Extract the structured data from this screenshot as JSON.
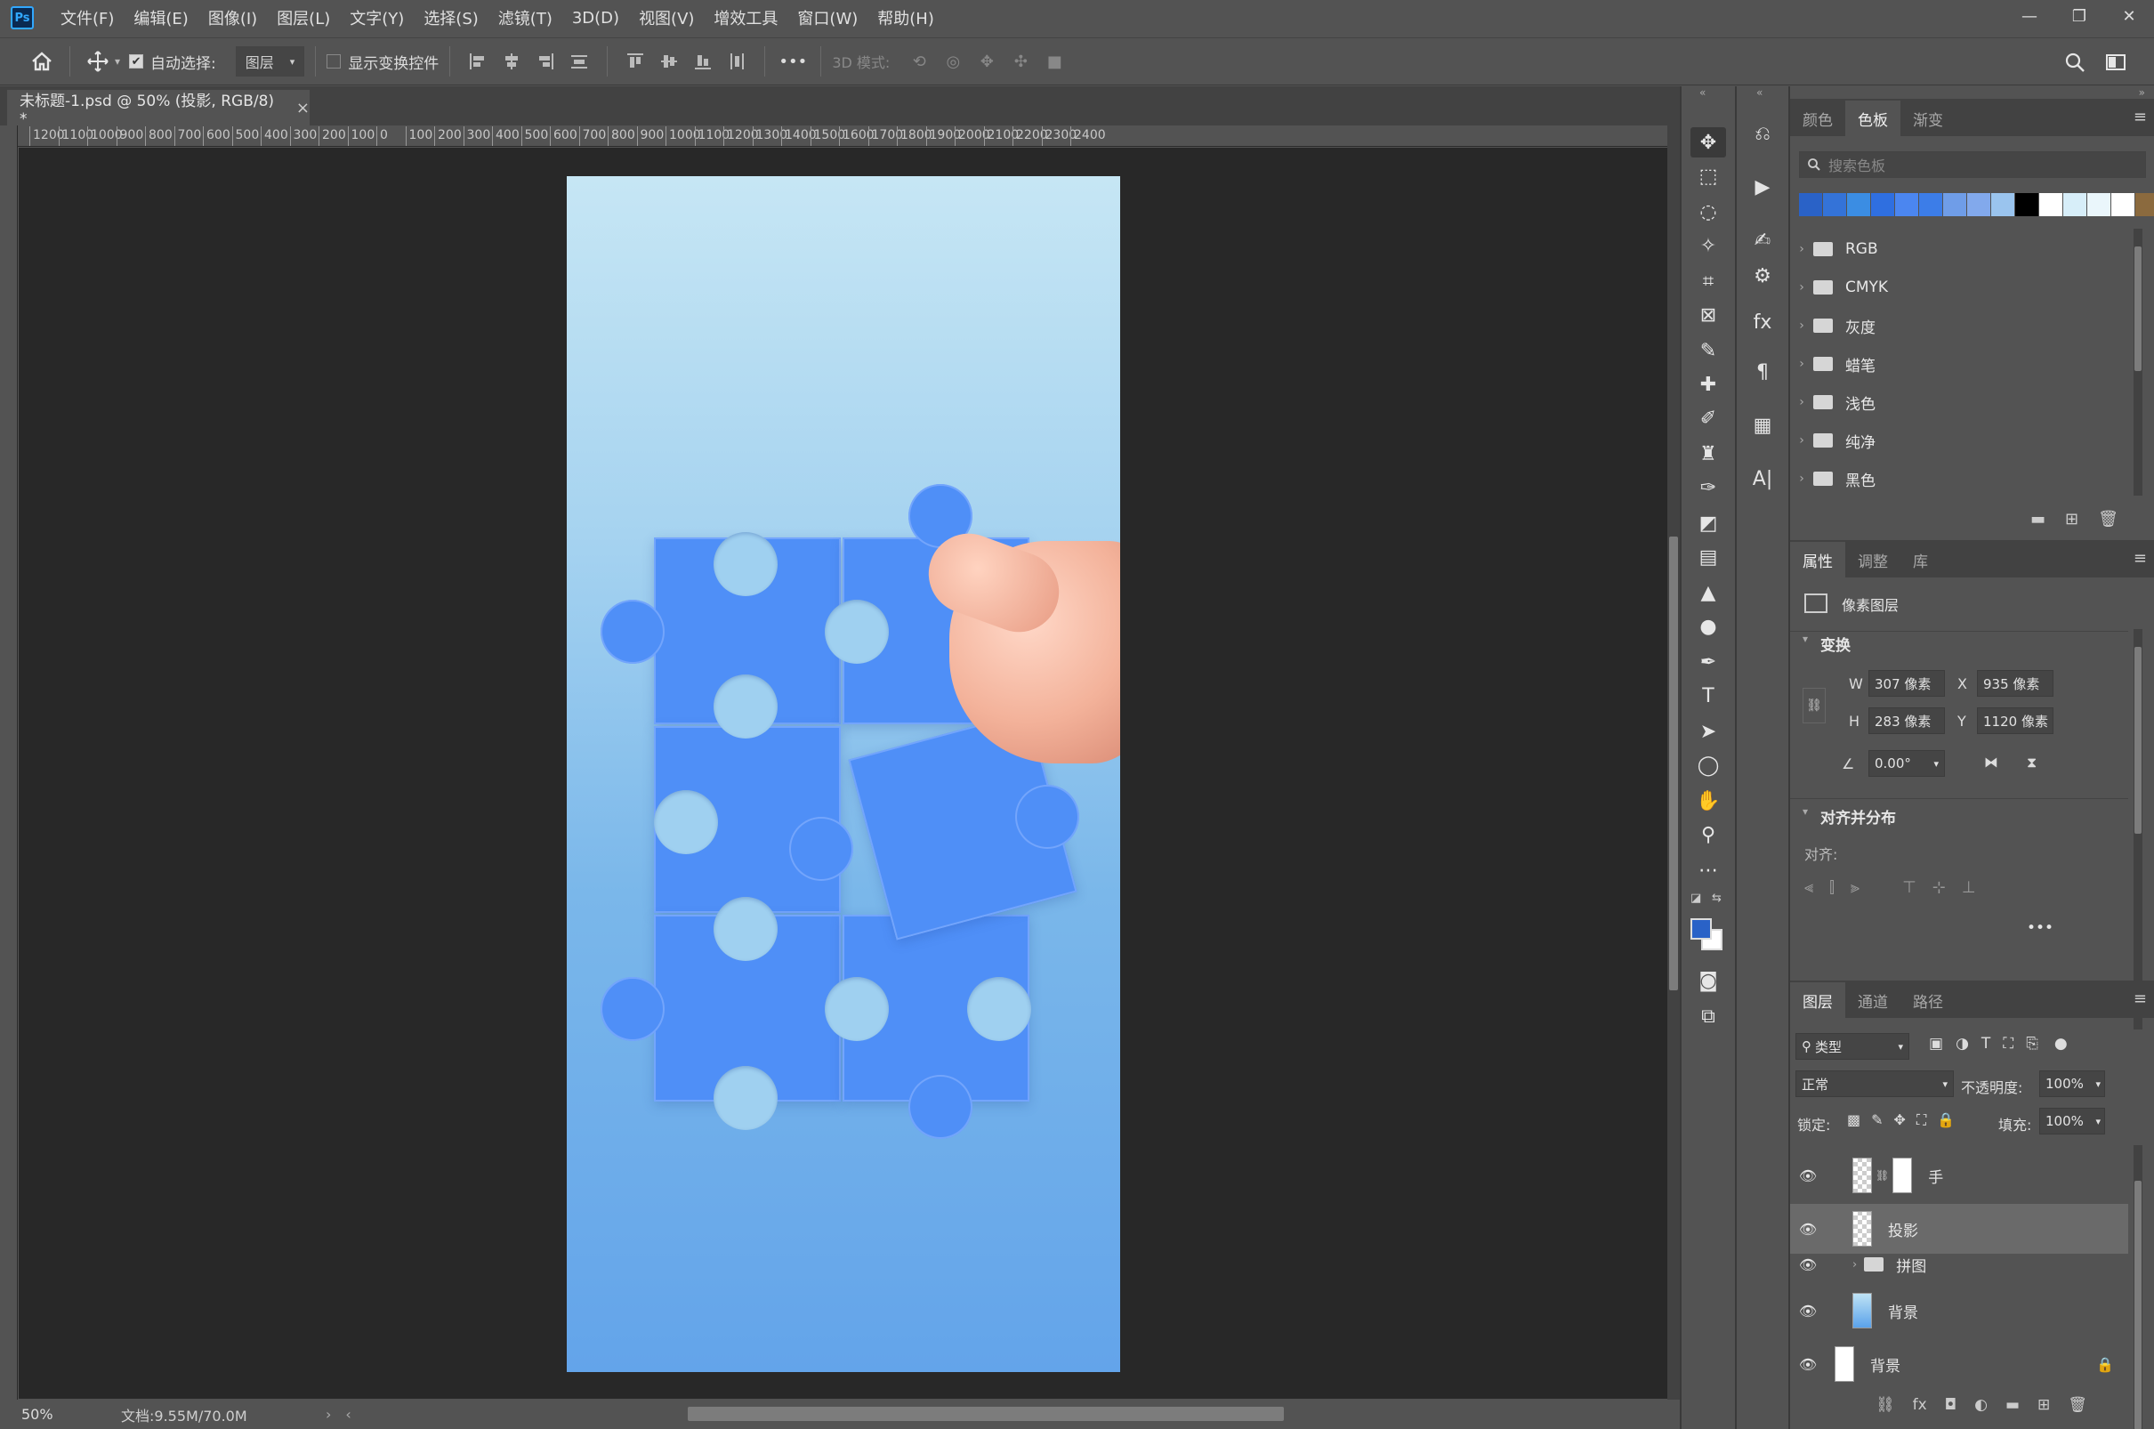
{
  "app": {
    "logo": "Ps"
  },
  "menu": [
    "文件(F)",
    "编辑(E)",
    "图像(I)",
    "图层(L)",
    "文字(Y)",
    "选择(S)",
    "滤镜(T)",
    "3D(D)",
    "视图(V)",
    "增效工具",
    "窗口(W)",
    "帮助(H)"
  ],
  "window_controls": {
    "minimize": "—",
    "restore": "❐",
    "close": "✕"
  },
  "options": {
    "auto_select_label": "自动选择:",
    "auto_select_target": "图层",
    "show_transform_label": "显示变换控件",
    "more": "•••",
    "mode_3d_label": "3D 模式:"
  },
  "document": {
    "tab_title": "未标题-1.psd @ 50% (投影, RGB/8) *",
    "close": "×",
    "zoom": "50%",
    "info": "文档:9.55M/70.0M"
  },
  "ruler_top": [
    "1200",
    "1100",
    "1000",
    "900",
    "800",
    "700",
    "600",
    "500",
    "400",
    "300",
    "200",
    "100",
    "0",
    "100",
    "200",
    "300",
    "400",
    "500",
    "600",
    "700",
    "800",
    "900",
    "1000",
    "1100",
    "1200",
    "1300",
    "1400",
    "1500",
    "1600",
    "1700",
    "1800",
    "1900",
    "2000",
    "2100",
    "2200",
    "2300",
    "2400"
  ],
  "swatches_panel": {
    "tabs": [
      "颜色",
      "色板",
      "渐变"
    ],
    "active_tab": 1,
    "search_placeholder": "搜索色板",
    "colors": [
      "#2a62c7",
      "#3473d8",
      "#3b8de3",
      "#2f6fe0",
      "#4b86f0",
      "#3c7de8",
      "#6f9de8",
      "#82a9ec",
      "#9ac4ee",
      "#000000",
      "#ffffff",
      "#d7eef9",
      "#eaf6fb",
      "#ffffff",
      "#8b6a3e"
    ],
    "groups": [
      "RGB",
      "CMYK",
      "灰度",
      "蜡笔",
      "浅色",
      "纯净",
      "黑色"
    ]
  },
  "properties_panel": {
    "tabs": [
      "属性",
      "调整",
      "库"
    ],
    "active_tab": 0,
    "layer_type": "像素图层",
    "transform_title": "变换",
    "w_label": "W",
    "w_value": "307 像素",
    "x_label": "X",
    "x_value": "935 像素",
    "h_label": "H",
    "h_value": "283 像素",
    "y_label": "Y",
    "y_value": "1120 像素",
    "angle_value": "0.00°",
    "align_title": "对齐并分布",
    "align_label": "对齐:",
    "more": "•••"
  },
  "layers_panel": {
    "tabs": [
      "图层",
      "通道",
      "路径"
    ],
    "active_tab": 0,
    "filter_label": "类型",
    "blend_mode": "正常",
    "opacity_label": "不透明度:",
    "opacity_value": "100%",
    "lock_label": "锁定:",
    "fill_label": "填充:",
    "fill_value": "100%",
    "layers": [
      {
        "name": "手",
        "thumb": "check",
        "selected": false
      },
      {
        "name": "投影",
        "thumb": "check",
        "selected": true
      },
      {
        "name": "拼图",
        "thumb": "folder",
        "selected": false
      },
      {
        "name": "背景",
        "thumb": "grad",
        "selected": false
      },
      {
        "name": "背景",
        "thumb": "white",
        "selected": false,
        "locked": true
      }
    ]
  },
  "tool_icons": [
    "move-icon",
    "marquee-icon",
    "lasso-icon",
    "magic-wand-icon",
    "crop-icon",
    "frame-icon",
    "eyedropper-icon",
    "healing-icon",
    "brush-icon",
    "stamp-icon",
    "history-brush-icon",
    "eraser-icon",
    "gradient-icon",
    "blur-icon",
    "dodge-icon",
    "pen-icon",
    "type-icon",
    "path-select-icon",
    "ellipse-icon",
    "hand-icon",
    "zoom-icon",
    "more-tools-icon"
  ]
}
